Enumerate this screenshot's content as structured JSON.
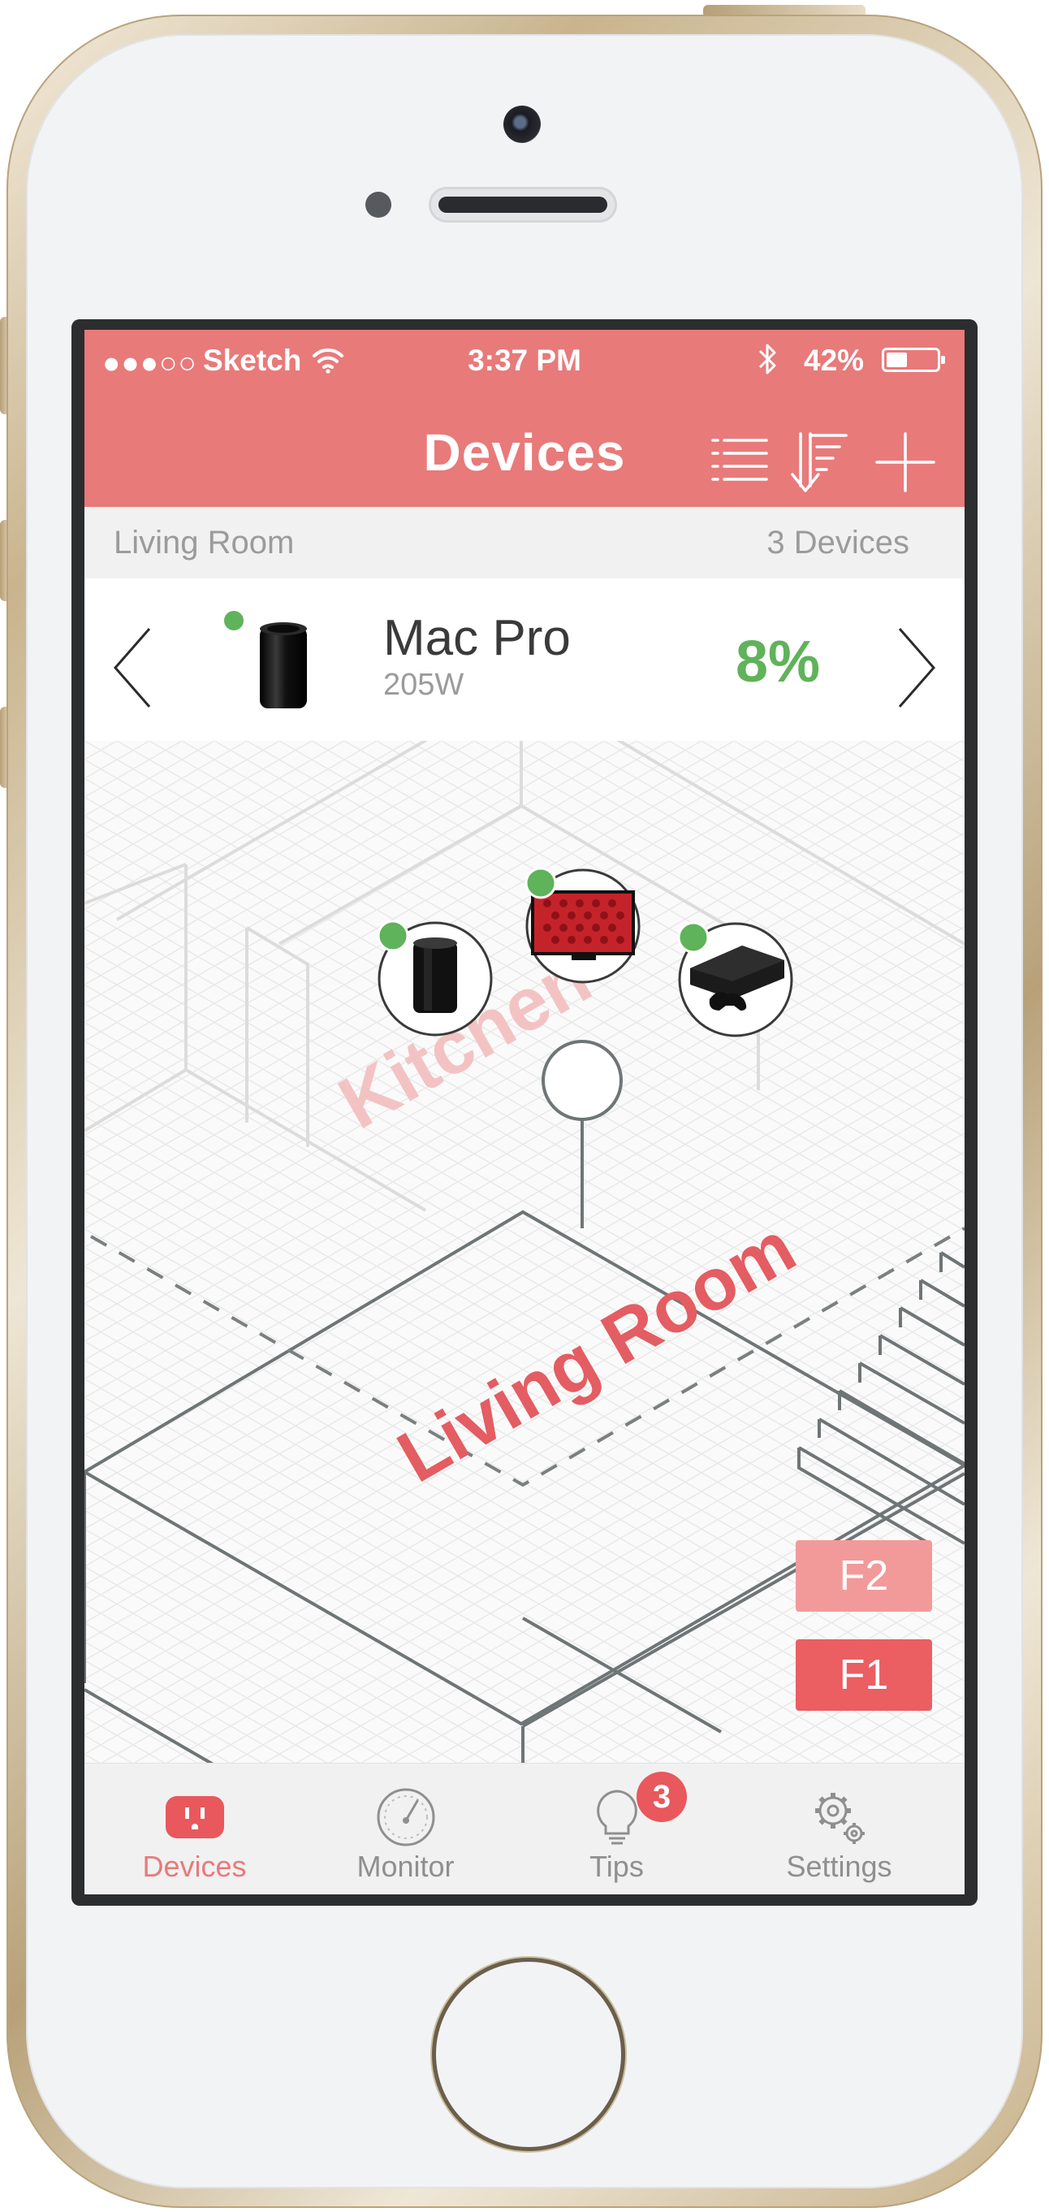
{
  "status_bar": {
    "signal": "●●●○○",
    "carrier": "Sketch",
    "time": "3:37 PM",
    "battery_percent_label": "42%",
    "battery_level": 0.42,
    "icons": [
      "wifi-icon",
      "bluetooth-icon",
      "battery-icon"
    ]
  },
  "nav": {
    "title": "Devices",
    "actions": [
      "list-icon",
      "sort-icon",
      "add-icon"
    ]
  },
  "section": {
    "room": "Living Room",
    "count": "3 Devices"
  },
  "selected_device": {
    "name": "Mac Pro",
    "power": "205W",
    "usage": "8%",
    "status_color": "#5fb35a"
  },
  "floorplan": {
    "rooms": {
      "kitchen": "Kitchen",
      "living_room": "Living Room"
    },
    "devices": [
      "mac-pro",
      "tv",
      "xbox-one"
    ],
    "floors": {
      "f2": "F2",
      "f1": "F1",
      "selected": "F1"
    }
  },
  "tab_bar": {
    "tabs": [
      {
        "label": "Devices",
        "icon": "outlet-icon",
        "active": true
      },
      {
        "label": "Monitor",
        "icon": "gauge-icon",
        "active": false
      },
      {
        "label": "Tips",
        "icon": "lightbulb-icon",
        "active": false,
        "badge": "3"
      },
      {
        "label": "Settings",
        "icon": "gears-icon",
        "active": false
      }
    ]
  },
  "colors": {
    "accent": "#e87a7a",
    "status_on": "#5fb35a",
    "floor_selected": "#eb5e62",
    "floor_unselected": "#f29a9a"
  }
}
